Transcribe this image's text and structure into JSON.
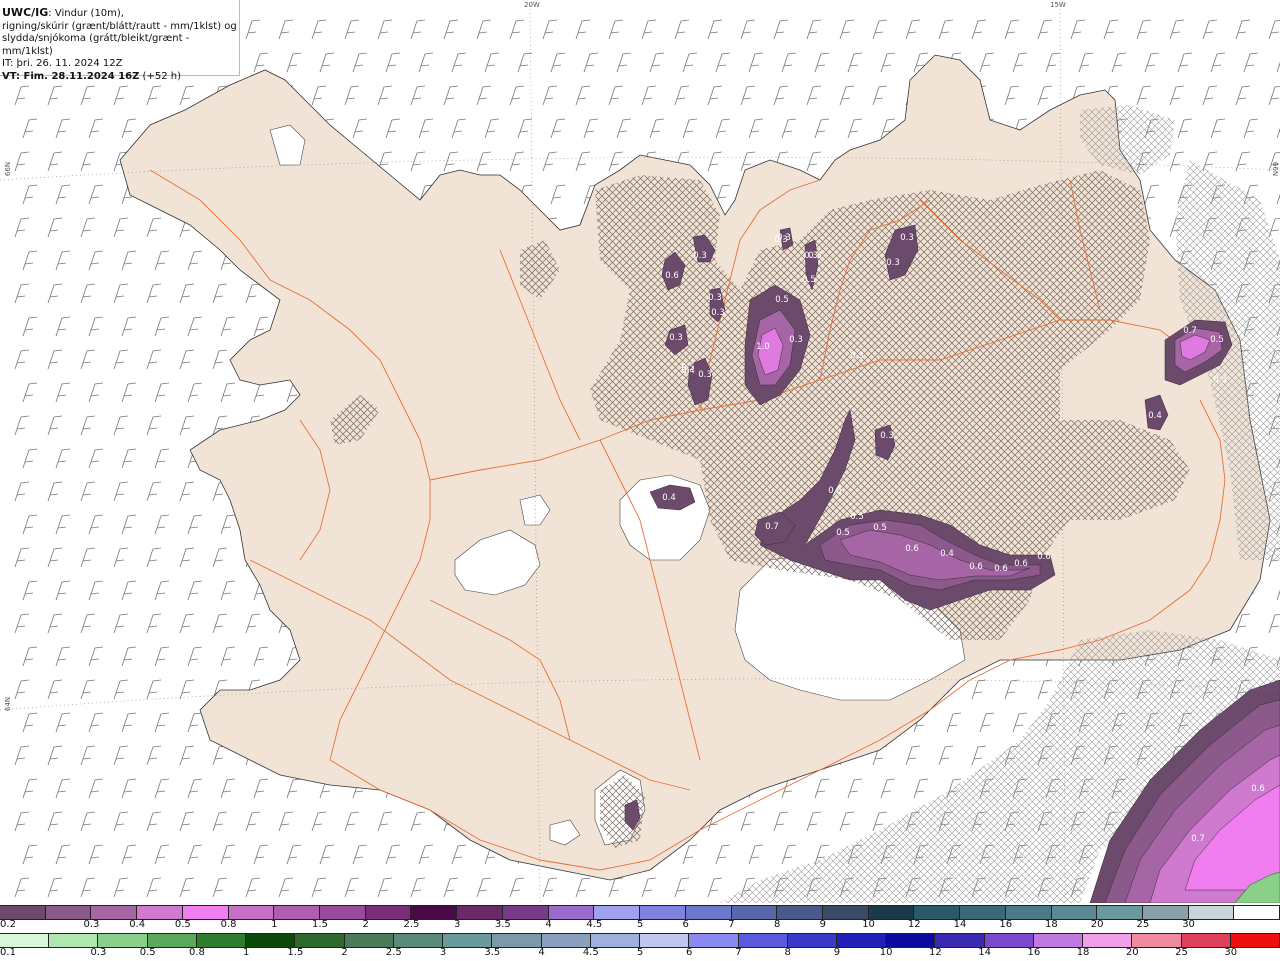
{
  "header": {
    "model": "UWC/IG",
    "line1_rest": ": Vindur (10m),",
    "line2": "rigning/skúrir (grænt/blátt/rautt - mm/1klst) og",
    "line3": "slydda/snjókoma (grátt/bleikt/grænt - mm/1klst)",
    "it": "IT: þri. 26. 11. 2024 12Z",
    "vt": "VT: Fim. 28.11.2024 16Z",
    "vt_offset": " (+52 h)"
  },
  "grid_labels": {
    "lon_20w": "20W",
    "lon_15w": "15W",
    "lat_66n_left": "66N",
    "lat_66n_right": "66N",
    "lat_64n_left": "64N"
  },
  "precip_labels": [
    {
      "text": "0.3"
    },
    {
      "text": "0.6"
    },
    {
      "text": "0.3"
    },
    {
      "text": "0.3"
    },
    {
      "text": "0.3"
    },
    {
      "text": "0.5"
    },
    {
      "text": "0.3"
    },
    {
      "text": "0.3"
    },
    {
      "text": "0.5"
    },
    {
      "text": "1.0"
    },
    {
      "text": "0.3"
    },
    {
      "text": "0.3"
    },
    {
      "text": "0.3"
    },
    {
      "text": "0.3"
    },
    {
      "text": "0.3"
    },
    {
      "text": "0.3"
    },
    {
      "text": "0.3"
    },
    {
      "text": "0.5"
    },
    {
      "text": "0.3"
    },
    {
      "text": "0.4"
    },
    {
      "text": "0.7"
    },
    {
      "text": "0.5"
    },
    {
      "text": "0.5"
    },
    {
      "text": "0.5"
    },
    {
      "text": "0.6"
    },
    {
      "text": "0.5"
    },
    {
      "text": "0.4"
    },
    {
      "text": "0.6"
    },
    {
      "text": "0.6"
    },
    {
      "text": "0.6"
    },
    {
      "text": "0.6"
    },
    {
      "text": "0.4"
    },
    {
      "text": "0.7"
    },
    {
      "text": "0.5"
    },
    {
      "text": "0.3"
    },
    {
      "text": "0.4"
    },
    {
      "text": "0.6"
    },
    {
      "text": "0.7"
    }
  ],
  "legend": {
    "snow_colors": [
      "#6b4a6b",
      "#8b5a8b",
      "#a666a6",
      "#cf79cf",
      "#f07ef0",
      "#c770c7",
      "#b05fb0",
      "#9a4a9a",
      "#7a2e7a",
      "#4a0a4a",
      "#6a2a6a",
      "#7a3a8a",
      "#9a6acc",
      "#a0a0ee",
      "#8080dd",
      "#6b78cc",
      "#5866aa",
      "#4a5a88",
      "#3a4a66",
      "#1a3a4a",
      "#2a5a6a",
      "#3a6a78",
      "#4a7a86",
      "#5a8a94",
      "#6a9aa0",
      "#8aa0aa",
      "#c8d4d8",
      "#ffffff"
    ],
    "snow_ticks": [
      "0.2",
      "0.3",
      "0.4",
      "0.5",
      "0.8",
      "1",
      "1.5",
      "2",
      "2.5",
      "3",
      "3.5",
      "4",
      "4.5",
      "5",
      "6",
      "7",
      "8",
      "9",
      "10",
      "12",
      "14",
      "16",
      "18",
      "20",
      "25",
      "30"
    ],
    "rain_colors": [
      "#d8f8d8",
      "#b0e6b0",
      "#8ad08a",
      "#5aaa5a",
      "#2e7e2e",
      "#0a4a0a",
      "#2e6a2e",
      "#4a7a5a",
      "#5a8a7a",
      "#6a9a9a",
      "#7a9aaa",
      "#8aa0c0",
      "#a0b0dd",
      "#c0c8f0",
      "#8a8aee",
      "#5a5add",
      "#3a3ac8",
      "#2020b8",
      "#0a0aa0",
      "#3a2ab0",
      "#7a4acc",
      "#c07ae0",
      "#f0a0e8",
      "#f08aa0",
      "#e0405a",
      "#ee1010"
    ],
    "rain_ticks": [
      "0.1",
      "0.3",
      "0.5",
      "0.8",
      "1",
      "1.5",
      "2",
      "2.5",
      "3",
      "3.5",
      "4",
      "4.5",
      "5",
      "6",
      "7",
      "8",
      "9",
      "10",
      "12",
      "14",
      "16",
      "18",
      "20",
      "25",
      "30"
    ]
  }
}
